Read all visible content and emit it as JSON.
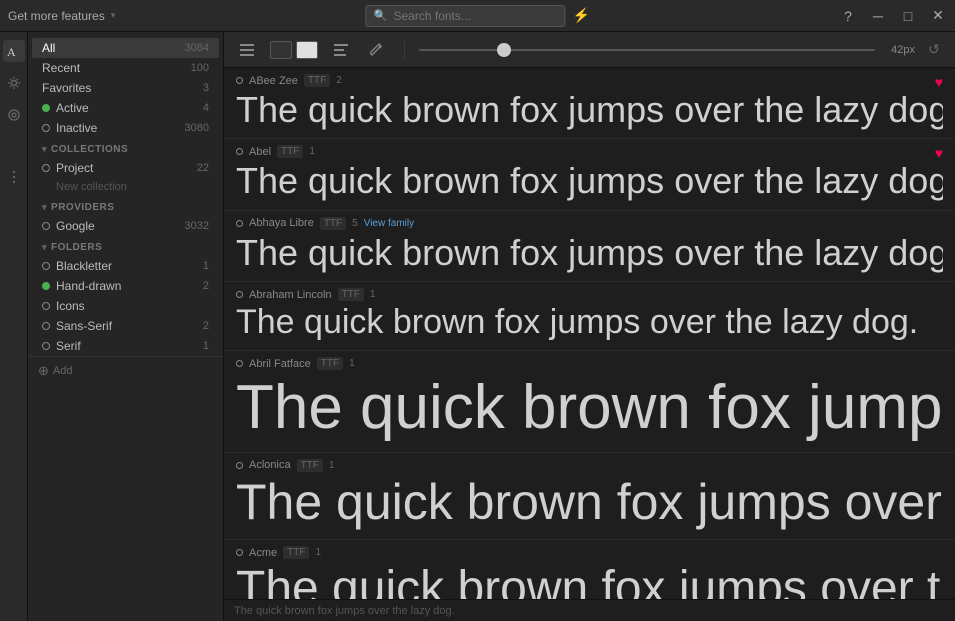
{
  "titlebar": {
    "left_label": "Get more features",
    "search_placeholder": "Search fonts...",
    "lightning_icon": "⚡",
    "help_icon": "?",
    "minimize_icon": "─",
    "maximize_icon": "□",
    "close_icon": "✕"
  },
  "sidebar": {
    "all_label": "All",
    "all_count": "3084",
    "recent_label": "Recent",
    "recent_count": "100",
    "favorites_label": "Favorites",
    "favorites_count": "3",
    "active_label": "Active",
    "active_count": "4",
    "inactive_label": "Inactive",
    "inactive_count": "3080",
    "collections_header": "COLLECTIONS",
    "project_label": "Project",
    "project_count": "22",
    "new_collection_label": "New collection",
    "providers_header": "PROVIDERS",
    "google_label": "Google",
    "google_count": "3032",
    "folders_header": "FOLDERS",
    "blackletter_label": "Blackletter",
    "blackletter_count": "1",
    "handdrawn_label": "Hand-drawn",
    "handdrawn_count": "2",
    "icons_label": "Icons",
    "icons_count": "",
    "sansserif_label": "Sans-Serif",
    "sansserif_count": "2",
    "serif_label": "Serif",
    "serif_count": "1",
    "add_label": "Add"
  },
  "toolbar": {
    "size_value": "42px",
    "size_min": "8",
    "size_max": "200",
    "size_current": "42"
  },
  "fonts": [
    {
      "name": "ABee Zee",
      "tag": "TTF",
      "count": "2",
      "preview_text": "The quick brown fox jumps over the lazy dog.",
      "preview_size": "36px",
      "favorited": true,
      "view_family": false
    },
    {
      "name": "Abel",
      "tag": "TTF",
      "count": "1",
      "preview_text": "The quick brown fox jumps over the lazy dog.",
      "preview_size": "36px",
      "favorited": true,
      "view_family": false
    },
    {
      "name": "Abhaya Libre",
      "tag": "TTF",
      "count": "5",
      "preview_text": "The quick brown fox jumps over the lazy dog.",
      "preview_size": "36px",
      "favorited": false,
      "view_family": true
    },
    {
      "name": "Abraham Lincoln",
      "tag": "TTF",
      "count": "1",
      "preview_text": "The quick brown fox jumps over the lazy dog.",
      "preview_size": "36px",
      "favorited": false,
      "view_family": false
    },
    {
      "name": "Abril Fatface",
      "tag": "TTF",
      "count": "1",
      "preview_text": "The quick brown fox jumps over the lazy dog.",
      "preview_size": "60px",
      "favorited": false,
      "view_family": false
    },
    {
      "name": "Aclonica",
      "tag": "TTF",
      "count": "1",
      "preview_text": "The quick brown fox jumps over the lazy do",
      "preview_size": "50px",
      "favorited": false,
      "view_family": false
    },
    {
      "name": "Acme",
      "tag": "TTF",
      "count": "1",
      "preview_text": "The quick brown fox jumps over the lazy dog.",
      "preview_size": "48px",
      "favorited": false,
      "view_family": false
    }
  ],
  "statusbar": {
    "text": "The quick brown fox jumps over the lazy dog."
  }
}
